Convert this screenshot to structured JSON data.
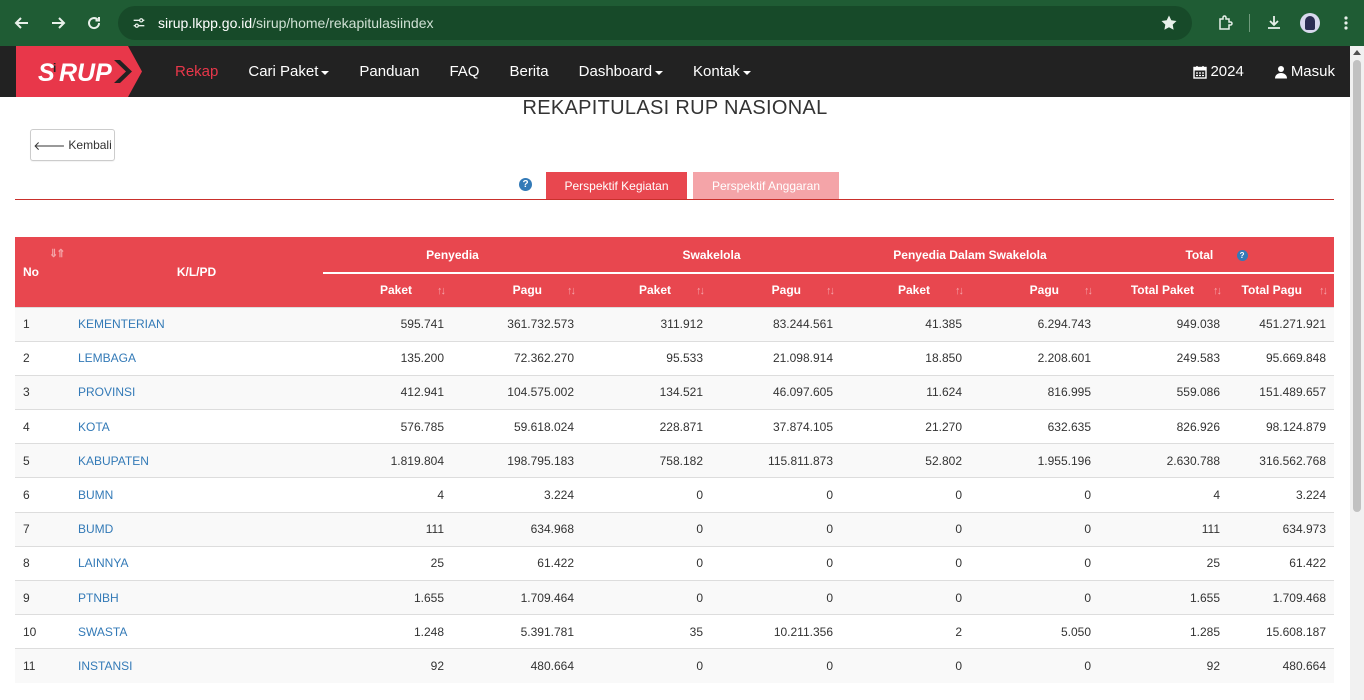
{
  "browser": {
    "url_host": "sirup.lkpp.go.id",
    "url_path": "/sirup/home/rekapitulasiindex"
  },
  "nav": {
    "logo_text": "SiRUP",
    "items": [
      {
        "label": "Rekap",
        "active": true,
        "dropdown": false
      },
      {
        "label": "Cari Paket",
        "active": false,
        "dropdown": true
      },
      {
        "label": "Panduan",
        "active": false,
        "dropdown": false
      },
      {
        "label": "FAQ",
        "active": false,
        "dropdown": false
      },
      {
        "label": "Berita",
        "active": false,
        "dropdown": false
      },
      {
        "label": "Dashboard",
        "active": false,
        "dropdown": true
      },
      {
        "label": "Kontak",
        "active": false,
        "dropdown": true
      }
    ],
    "year": "2024",
    "login": "Masuk"
  },
  "page": {
    "title": "REKAPITULASI RUP NASIONAL",
    "back_label": "Kembali",
    "tabs": [
      "Perspektif Kegiatan",
      "Perspektif Anggaran"
    ]
  },
  "table": {
    "headers": {
      "no": "No",
      "klpd": "K/L/PD",
      "penyedia": "Penyedia",
      "swakelola": "Swakelola",
      "pds": "Penyedia Dalam Swakelola",
      "total": "Total",
      "paket": "Paket",
      "pagu": "Pagu",
      "total_paket": "Total Paket",
      "total_pagu": "Total Pagu"
    },
    "rows": [
      {
        "no": "1",
        "name": "KEMENTERIAN",
        "p_paket": "595.741",
        "p_pagu": "361.732.573",
        "s_paket": "311.912",
        "s_pagu": "83.244.561",
        "d_paket": "41.385",
        "d_pagu": "6.294.743",
        "t_paket": "949.038",
        "t_pagu": "451.271.921"
      },
      {
        "no": "2",
        "name": "LEMBAGA",
        "p_paket": "135.200",
        "p_pagu": "72.362.270",
        "s_paket": "95.533",
        "s_pagu": "21.098.914",
        "d_paket": "18.850",
        "d_pagu": "2.208.601",
        "t_paket": "249.583",
        "t_pagu": "95.669.848"
      },
      {
        "no": "3",
        "name": "PROVINSI",
        "p_paket": "412.941",
        "p_pagu": "104.575.002",
        "s_paket": "134.521",
        "s_pagu": "46.097.605",
        "d_paket": "11.624",
        "d_pagu": "816.995",
        "t_paket": "559.086",
        "t_pagu": "151.489.657"
      },
      {
        "no": "4",
        "name": "KOTA",
        "p_paket": "576.785",
        "p_pagu": "59.618.024",
        "s_paket": "228.871",
        "s_pagu": "37.874.105",
        "d_paket": "21.270",
        "d_pagu": "632.635",
        "t_paket": "826.926",
        "t_pagu": "98.124.879"
      },
      {
        "no": "5",
        "name": "KABUPATEN",
        "p_paket": "1.819.804",
        "p_pagu": "198.795.183",
        "s_paket": "758.182",
        "s_pagu": "115.811.873",
        "d_paket": "52.802",
        "d_pagu": "1.955.196",
        "t_paket": "2.630.788",
        "t_pagu": "316.562.768"
      },
      {
        "no": "6",
        "name": "BUMN",
        "p_paket": "4",
        "p_pagu": "3.224",
        "s_paket": "0",
        "s_pagu": "0",
        "d_paket": "0",
        "d_pagu": "0",
        "t_paket": "4",
        "t_pagu": "3.224"
      },
      {
        "no": "7",
        "name": "BUMD",
        "p_paket": "111",
        "p_pagu": "634.968",
        "s_paket": "0",
        "s_pagu": "0",
        "d_paket": "0",
        "d_pagu": "0",
        "t_paket": "111",
        "t_pagu": "634.973"
      },
      {
        "no": "8",
        "name": "LAINNYA",
        "p_paket": "25",
        "p_pagu": "61.422",
        "s_paket": "0",
        "s_pagu": "0",
        "d_paket": "0",
        "d_pagu": "0",
        "t_paket": "25",
        "t_pagu": "61.422"
      },
      {
        "no": "9",
        "name": "PTNBH",
        "p_paket": "1.655",
        "p_pagu": "1.709.464",
        "s_paket": "0",
        "s_pagu": "0",
        "d_paket": "0",
        "d_pagu": "0",
        "t_paket": "1.655",
        "t_pagu": "1.709.468"
      },
      {
        "no": "10",
        "name": "SWASTA",
        "p_paket": "1.248",
        "p_pagu": "5.391.781",
        "s_paket": "35",
        "s_pagu": "10.211.356",
        "d_paket": "2",
        "d_pagu": "5.050",
        "t_paket": "1.285",
        "t_pagu": "15.608.187"
      },
      {
        "no": "11",
        "name": "INSTANSI",
        "p_paket": "92",
        "p_pagu": "480.664",
        "s_paket": "0",
        "s_pagu": "0",
        "d_paket": "0",
        "d_pagu": "0",
        "t_paket": "92",
        "t_pagu": "480.664"
      }
    ]
  }
}
